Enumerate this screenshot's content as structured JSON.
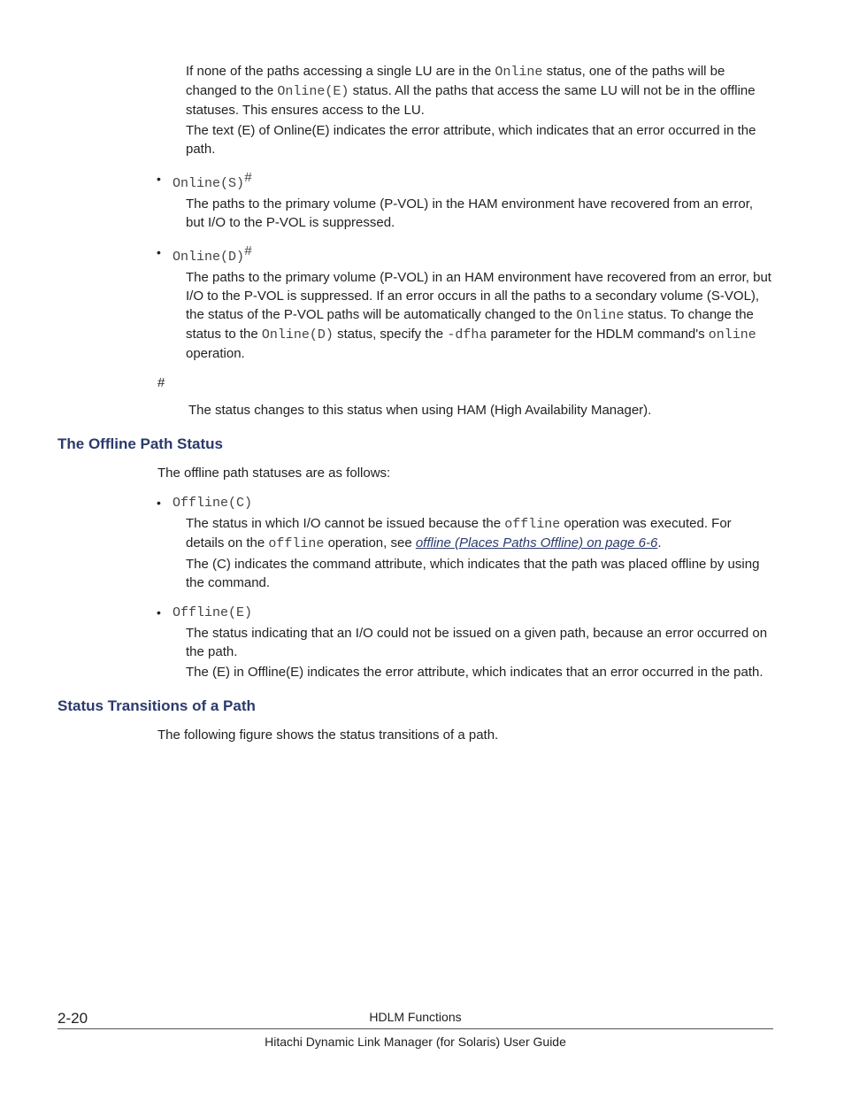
{
  "intro": {
    "p1a": "If none of the paths accessing a single LU are in the ",
    "p1code": "Online",
    "p1b": " status, one of the paths will be changed to the ",
    "p1code2": "Online(E)",
    "p1c": " status. All the paths that access the same LU will not be in the offline statuses. This ensures access to the LU.",
    "p2": "The text (E) of Online(E) indicates the error attribute, which indicates that an error occurred in the path."
  },
  "onlineS": {
    "code": "Online(S)",
    "sup": "#",
    "body": "The paths to the primary volume (P-VOL) in the HAM environment have recovered from an error, but I/O to the P-VOL is suppressed."
  },
  "onlineD": {
    "code": "Online(D)",
    "sup": "#",
    "p1a": "The paths to the primary volume (P-VOL) in an HAM environment have recovered from an error, but I/O to the P-VOL is suppressed. If an error occurs in all the paths to a secondary volume (S-VOL), the status of the P-VOL paths will be automatically changed to the ",
    "p1code1": "Online",
    "p1b": " status. To change the status to the ",
    "p1code2": "Online(D)",
    "p1c": " status, specify the ",
    "p1code3": "-dfha",
    "p1d": " parameter for the HDLM command's ",
    "p1code4": "online",
    "p1e": " operation."
  },
  "hashnote": {
    "sym": "#",
    "body": "The status changes to this status when using HAM (High Availability Manager)."
  },
  "offlineHeading": "The Offline Path Status",
  "offlineIntro": "The offline path statuses are as follows:",
  "offlineC": {
    "code": "Offline(C)",
    "p1a": "The status in which I/O cannot be issued because the ",
    "p1code1": "offline",
    "p1b": " operation was executed. For details on the ",
    "p1code2": "offline",
    "p1c": " operation, see ",
    "link": "offline (Places Paths Offline) on page 6-6",
    "p1d": ".",
    "p2": "The (C) indicates the command attribute, which indicates that the path was placed offline by using the command."
  },
  "offlineE": {
    "code": "Offline(E)",
    "p1": "The status indicating that an I/O could not be issued on a given path, because an error occurred on the path.",
    "p2": "The (E) in Offline(E) indicates the error attribute, which indicates that an error occurred in the path."
  },
  "transitionsHeading": "Status Transitions of a Path",
  "transitionsIntro": "The following figure shows the status transitions of a path.",
  "footer": {
    "pageNum": "2-20",
    "title": "HDLM Functions",
    "sub": "Hitachi Dynamic Link Manager (for Solaris) User Guide"
  }
}
